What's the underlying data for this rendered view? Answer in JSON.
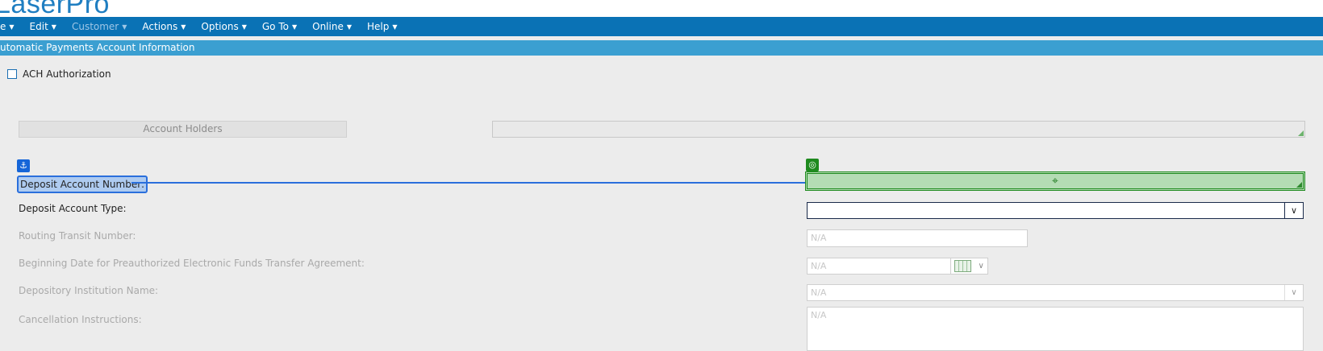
{
  "app": {
    "title": "LaserPro"
  },
  "menu": [
    {
      "label": "e",
      "enabled": true
    },
    {
      "label": "Edit",
      "enabled": true
    },
    {
      "label": "Customer",
      "enabled": false
    },
    {
      "label": "Actions",
      "enabled": true
    },
    {
      "label": "Options",
      "enabled": true
    },
    {
      "label": "Go To",
      "enabled": true
    },
    {
      "label": "Online",
      "enabled": true
    },
    {
      "label": "Help",
      "enabled": true
    }
  ],
  "section": {
    "title": "utomatic Payments Account Information"
  },
  "ach": {
    "label": "ACH Authorization",
    "checked": false
  },
  "account_holders": {
    "button_label": "Account Holders"
  },
  "fields": {
    "deposit_account_number": {
      "label": "Deposit Account Number:",
      "value": ""
    },
    "deposit_account_type": {
      "label": "Deposit Account Type:",
      "value": ""
    },
    "routing_transit_number": {
      "label": "Routing Transit Number:",
      "placeholder": "N/A"
    },
    "beginning_date": {
      "label": "Beginning Date for Preauthorized Electronic Funds Transfer Agreement:",
      "placeholder": "N/A"
    },
    "depository_institution": {
      "label": "Depository Institution Name:",
      "placeholder": "N/A"
    },
    "cancellation_instructions": {
      "label": "Cancellation Instructions:",
      "placeholder": "N/A"
    }
  },
  "icons": {
    "anchor": "anchor-icon",
    "target": "target-icon",
    "crosshair": "crosshair-icon",
    "calendar": "calendar-icon"
  },
  "colors": {
    "menubar": "#0a72b5",
    "section_bar": "#3b9fd1",
    "anchor_blue": "#2a6fdc",
    "target_green": "#1e8a1e"
  }
}
